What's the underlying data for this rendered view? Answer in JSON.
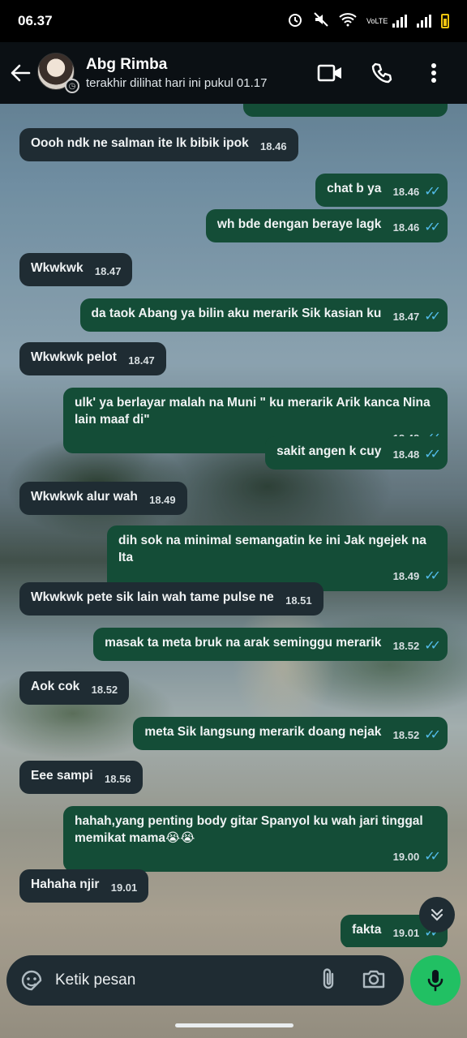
{
  "status_bar": {
    "time": "06.37",
    "network_label": "VoLTE"
  },
  "header": {
    "contact_name": "Abg Rimba",
    "last_seen": "terakhir dilihat hari ini pukul 01.17"
  },
  "messages": [
    {
      "dir": "in",
      "text": "Oooh ndk ne salman ite lk bibik ipok",
      "time": "18.46"
    },
    {
      "dir": "out",
      "text": "chat b ya",
      "time": "18.46"
    },
    {
      "dir": "out",
      "text": "wh bde dengan beraye lagk",
      "time": "18.46"
    },
    {
      "dir": "in",
      "text": "Wkwkwk",
      "time": "18.47"
    },
    {
      "dir": "out",
      "text": "da taok Abang ya bilin aku merarik Sik kasian ku",
      "time": "18.47"
    },
    {
      "dir": "in",
      "text": "Wkwkwk pelot",
      "time": "18.47"
    },
    {
      "dir": "out",
      "text": "ulk' ya berlayar malah na Muni \" ku merarik Arik kanca Nina lain maaf di\"",
      "time": "18.48"
    },
    {
      "dir": "out",
      "text": "sakit angen k cuy",
      "time": "18.48"
    },
    {
      "dir": "in",
      "text": "Wkwkwk alur wah",
      "time": "18.49"
    },
    {
      "dir": "out",
      "text": "dih sok na minimal semangatin ke ini Jak ngejek na Ita",
      "time": "18.49"
    },
    {
      "dir": "in",
      "text": "Wkwkwk pete sik lain wah tame pulse ne",
      "time": "18.51"
    },
    {
      "dir": "out",
      "text": "masak ta meta bruk na arak seminggu merarik",
      "time": "18.52"
    },
    {
      "dir": "in",
      "text": "Aok cok",
      "time": "18.52"
    },
    {
      "dir": "out",
      "text": "meta Sik langsung merarik doang nejak",
      "time": "18.52"
    },
    {
      "dir": "in",
      "text": "Eee sampi",
      "time": "18.56"
    },
    {
      "dir": "out",
      "text": "hahah,yang penting body gitar Spanyol ku wah jari tinggal memikat mama😭😭",
      "time": "19.00"
    },
    {
      "dir": "in",
      "text": "Hahaha njir",
      "time": "19.01"
    },
    {
      "dir": "out",
      "text": "fakta",
      "time": "19.01"
    }
  ],
  "input": {
    "placeholder": "Ketik pesan"
  },
  "icons": {
    "back": "arrow-left-icon",
    "video": "video-camera-icon",
    "call": "phone-icon",
    "menu": "more-vert-icon",
    "emoji": "sticker-icon",
    "attach": "paperclip-icon",
    "camera": "camera-icon",
    "mic": "microphone-icon",
    "scroll": "double-chevron-down-icon"
  },
  "colors": {
    "incoming_bubble": "#1f2c33",
    "outgoing_bubble": "#144d37",
    "read_ticks": "#53bdeb",
    "mic_button": "#21c063"
  }
}
